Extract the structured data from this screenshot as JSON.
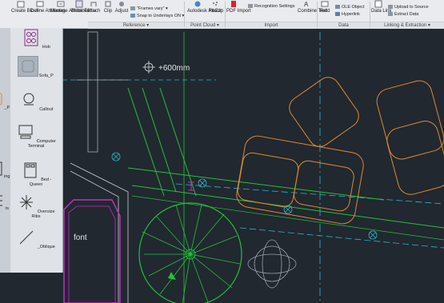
{
  "ribbon": {
    "buttons": [
      {
        "label": "Create Block"
      },
      {
        "label": "Define Attributes"
      },
      {
        "label": "Manage Attributes"
      },
      {
        "label": "Block Editor"
      },
      {
        "label": "Attach"
      },
      {
        "label": "Clip"
      },
      {
        "label": "Adjust"
      },
      {
        "label": "Autodesk ReCap"
      },
      {
        "label": "Attach"
      },
      {
        "label": "PDF Import"
      },
      {
        "label": "Combine Text"
      },
      {
        "label": "Field"
      },
      {
        "label": "Data Link"
      }
    ],
    "frames_vary": "\"Frames vary\"",
    "snap_underlays": "Snap to Underlays ON",
    "recognition": "Recognition Settings",
    "ole_object": "OLE Object",
    "hyperlink": "Hyperlink",
    "upload_source": "Upload to Source",
    "extract_data": "Extract Data",
    "panels": [
      "Reference",
      "Point Cloud",
      "Import",
      "Data",
      "Linking & Extraction"
    ]
  },
  "palette": {
    "items": [
      "Hob",
      "Sofa_P",
      "_P",
      "Callout",
      "Computer Terminal",
      "ing",
      "Bed - Queen",
      "rs",
      "Oversize Ribs",
      "_Oblique"
    ]
  },
  "canvas": {
    "dimension_text": "+600mm",
    "font_label": "font"
  },
  "colors": {
    "background": "#212830",
    "orange": "#e08a2c",
    "green": "#23c23a",
    "magenta": "#c030c0",
    "cyan": "#28b8c8"
  }
}
